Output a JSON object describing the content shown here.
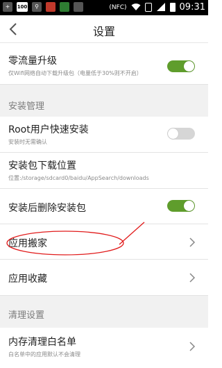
{
  "statusbar": {
    "left_icons": [
      "plus",
      "100",
      "usb",
      "app",
      "app",
      "app"
    ],
    "battery_small": "100",
    "nfc": "(NFC)",
    "time": "09:31"
  },
  "header": {
    "title": "设置"
  },
  "sections": {
    "install": "安装管理",
    "clean": "清理设置"
  },
  "rows": {
    "zero_traffic": {
      "title": "零流量升级",
      "sub": "仅Wifi网络自动下载升级包（电量低于30%则不开启）",
      "toggle": true
    },
    "root_install": {
      "title": "Root用户快速安装",
      "sub": "安装时无需确认",
      "toggle": false
    },
    "download_location": {
      "title": "安装包下载位置",
      "sub": "位置:/storage/sdcard0/baidu/AppSearch/downloads"
    },
    "delete_after_install": {
      "title": "安装后删除安装包",
      "toggle": true
    },
    "app_move": {
      "title": "应用搬家"
    },
    "app_favorites": {
      "title": "应用收藏"
    },
    "memory_whitelist": {
      "title": "内存清理白名单",
      "sub": "白名单中的应用默认不会清理"
    }
  },
  "colors": {
    "toggle_on": "#5f9d2c",
    "toggle_off": "#d6d6d6",
    "annotation": "#e11b1b"
  }
}
